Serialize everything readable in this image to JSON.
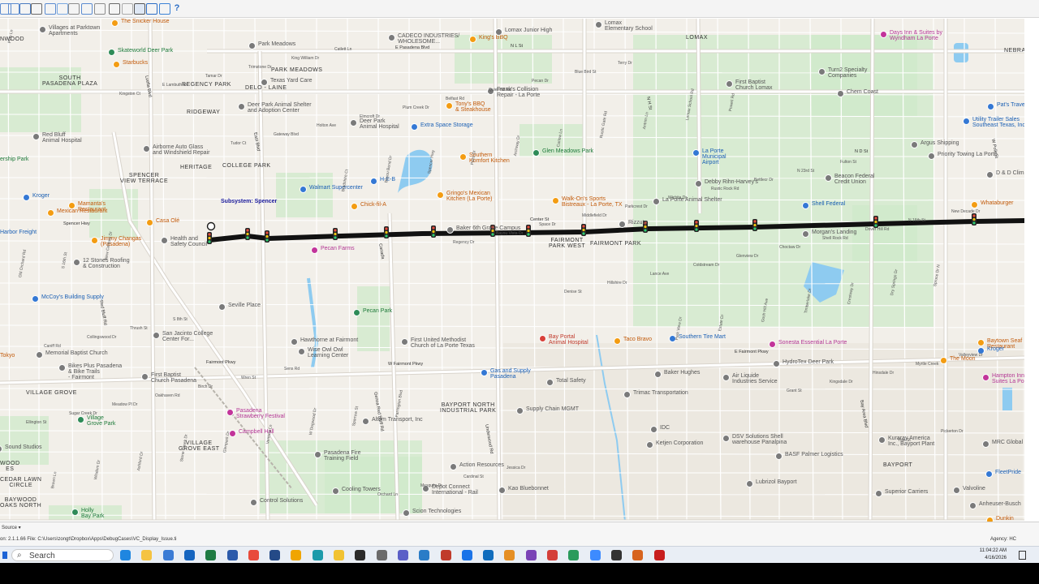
{
  "colors": {
    "map_bg": "#f2efe9",
    "park": "#cfe9c9",
    "water": "#8ecbf0",
    "road_major": "#ffffff",
    "road_stroke": "#d9d4cc",
    "corridor": "#111111"
  },
  "toolbar": {
    "icons": [
      "file-icon",
      "open-icon",
      "save-icon",
      "print-icon",
      "text-icon",
      "image-icon",
      "layout-icon",
      "chart-icon",
      "table-icon",
      "crop-icon",
      "pointer-icon",
      "select-icon",
      "zoom-icon",
      "pin-icon",
      "help-icon"
    ]
  },
  "map": {
    "corridor_label": "Subsystem: Spencer",
    "areas": [
      {
        "id": "pasadena-plaza",
        "text": "SOUTH\nPASADENA PLAZA"
      },
      {
        "id": "spencer-view",
        "text": "SPENCER\nVIEW TERRACE"
      },
      {
        "id": "heritage",
        "text": "HERITAGE"
      },
      {
        "id": "college-park",
        "text": "COLLEGE PARK"
      },
      {
        "id": "regency-park",
        "text": "REGENCY PARK"
      },
      {
        "id": "ridgeway",
        "text": "RIDGEWAY"
      },
      {
        "id": "delo-laine",
        "text": "DELO - LAINE"
      },
      {
        "id": "park-meadows",
        "text": "PARK MEADOWS"
      },
      {
        "id": "fairmont-park",
        "text": "FAIRMONT PARK"
      },
      {
        "id": "fairmont-park-west",
        "text": "FAIRMONT\nPARK WEST"
      },
      {
        "id": "village-grove",
        "text": "VILLAGE GROVE"
      },
      {
        "id": "village-grove-east",
        "text": "VILLAGE\nGROVE EAST"
      },
      {
        "id": "baypor-north",
        "text": "BAYPORT NORTH\nINDUSTRIAL PARK"
      },
      {
        "id": "bayport",
        "text": "BAYPORT"
      },
      {
        "id": "lomax",
        "text": "LOMAX"
      },
      {
        "id": "cedar-lawn",
        "text": "CEDAR LAWN\nCIRCLE"
      },
      {
        "id": "baywood",
        "text": "BAYWOOD\nOAKS NORTH"
      },
      {
        "id": "nebraska",
        "text": "NEBRA"
      },
      {
        "id": "lynwood",
        "text": "NWOOD"
      },
      {
        "id": "woods",
        "text": "WOOD\nES"
      }
    ],
    "pois": [
      {
        "t": "Villages at Parktown\nApartments",
        "c": "d"
      },
      {
        "t": "Skateworld Deer Park",
        "c": "g"
      },
      {
        "t": "Starbucks",
        "c": "o"
      },
      {
        "t": "Park Meadows",
        "c": "d"
      },
      {
        "t": "CADECO INDUSTRIES/\nWHOLESOME...",
        "c": "d"
      },
      {
        "t": "King's BBQ",
        "c": "o"
      },
      {
        "t": "Lomax Junior High",
        "c": "d"
      },
      {
        "t": "Lomax\nElementary School",
        "c": "d"
      },
      {
        "t": "Days Inn & Suites by\nWyndham La Porte",
        "c": "p"
      },
      {
        "t": "Texas Yard Care",
        "c": "d"
      },
      {
        "t": "Frank's Collision\nRepair - La Porte",
        "c": "d"
      },
      {
        "t": "First Baptist\nChurch Lomax",
        "c": "d"
      },
      {
        "t": "Turn2 Specialty\nCompanies",
        "c": "d"
      },
      {
        "t": "Chem Coast",
        "c": "d"
      },
      {
        "t": "Pat's Travel C",
        "c": "b"
      },
      {
        "t": "Deer Park Animal Shelter\nand Adoption Center",
        "c": "d"
      },
      {
        "t": "Tony's BBQ\n& Steakhouse",
        "c": "o"
      },
      {
        "t": "Deer Park\nAnimal Hospital",
        "c": "d"
      },
      {
        "t": "Extra Space Storage",
        "c": "b"
      },
      {
        "t": "Red Bluff\nAnimal Hospital",
        "c": "d"
      },
      {
        "t": "Airborne Auto Glass\nand Windshield Repair",
        "c": "d"
      },
      {
        "t": "Southern\nKomfort Kitchen",
        "c": "o"
      },
      {
        "t": "Glen Meadows Park",
        "c": "g"
      },
      {
        "t": "Utility Trailer Sales\nSoutheast Texas, Inc",
        "c": "b"
      },
      {
        "t": "Argus Shipping",
        "c": "d"
      },
      {
        "t": "Priority Towing La Porte",
        "c": "d"
      },
      {
        "t": "La Porte\nMunicipal\nAirport",
        "c": "b"
      },
      {
        "t": "Debby Rihn-Harvey's",
        "c": "d"
      },
      {
        "t": "Beacon Federal\nCredit Union",
        "c": "d"
      },
      {
        "t": "D & D Climate Con",
        "c": "d"
      },
      {
        "t": "Walmart Supercenter",
        "c": "b"
      },
      {
        "t": "H-E-B",
        "c": "b"
      },
      {
        "t": "Kroger",
        "c": "b"
      },
      {
        "t": "Mamanta's\nRestaurant",
        "c": "o"
      },
      {
        "t": "Mexican Restaurant",
        "c": "o"
      },
      {
        "t": "Gringo's Mexican\nKitchen (La Porte)",
        "c": "o"
      },
      {
        "t": "Chick-fil-A",
        "c": "o"
      },
      {
        "t": "Walk-On's Sports\nBistreaux - La Porte, TX",
        "c": "o"
      },
      {
        "t": "La Porte Animal Shelter",
        "c": "d"
      },
      {
        "t": "Shell Federal",
        "c": "b"
      },
      {
        "t": "Whataburger",
        "c": "o"
      },
      {
        "t": "Casa Olé",
        "c": "o"
      },
      {
        "t": "Harbor Freight",
        "c": "b"
      },
      {
        "t": "Jimmy Changas\n(Pasadena)",
        "c": "o"
      },
      {
        "t": "Health and\nSafety Council",
        "c": "d"
      },
      {
        "t": "Baker 6th Grade Campus",
        "c": "d"
      },
      {
        "t": "Rizzuto",
        "c": "d"
      },
      {
        "t": "Morgan's Landing",
        "c": "d"
      },
      {
        "t": "Pecan Farms",
        "c": "p"
      },
      {
        "t": "12 Stones Roofing\n& Construction",
        "c": "d"
      },
      {
        "t": "McCoy's Building Supply",
        "c": "b"
      },
      {
        "t": "Seville Place",
        "c": "d"
      },
      {
        "t": "Pecan Park",
        "c": "g"
      },
      {
        "t": "San Jacinto College\nCenter For...",
        "c": "d"
      },
      {
        "t": "Hawthorne at Fairmont",
        "c": "d"
      },
      {
        "t": "Wise Owl Owl\nLearning Center",
        "c": "d"
      },
      {
        "t": "First United Methodist\nChurch of La Porte Texas",
        "c": "d"
      },
      {
        "t": "Bay Portal\nAnimal Hospital",
        "c": "r"
      },
      {
        "t": "Taco Bravo",
        "c": "o"
      },
      {
        "t": "Southern Tire Mart",
        "c": "b"
      },
      {
        "t": "Sonesta Essential La Porte",
        "c": "p"
      },
      {
        "t": "Baytown Seaf\nRestaurant",
        "c": "o"
      },
      {
        "t": "Kroger",
        "c": "b"
      },
      {
        "t": "Tokyo",
        "c": "o"
      },
      {
        "t": "Memorial Baptist Church",
        "c": "d"
      },
      {
        "t": "HydroTex Deer Park",
        "c": "d"
      },
      {
        "t": "The Moon",
        "c": "o"
      },
      {
        "t": "Bikes Plus Pasadena\n& Bike Trails\n- Fairmont",
        "c": "d"
      },
      {
        "t": "First Baptist\nChurch Pasadena",
        "c": "d"
      },
      {
        "t": "Gas and Supply\nPasadena",
        "c": "b"
      },
      {
        "t": "Total Safety",
        "c": "d"
      },
      {
        "t": "Baker Hughes",
        "c": "d"
      },
      {
        "t": "Air Liquide\nIndustries Service",
        "c": "d"
      },
      {
        "t": "Hampton Inn &\nSuites La Porte",
        "c": "p"
      },
      {
        "t": "Trimac Transportation",
        "c": "d"
      },
      {
        "t": "Pasadena\nStrawberry Festival",
        "c": "p"
      },
      {
        "t": "Village\nGrove Park",
        "c": "g"
      },
      {
        "t": "Supply Chain MGMT",
        "c": "d"
      },
      {
        "t": "Altom Transport, Inc",
        "c": "d"
      },
      {
        "t": "Campbell Hall",
        "c": "p"
      },
      {
        "t": "IDC",
        "c": "d"
      },
      {
        "t": "Ketjen Corporation",
        "c": "d"
      },
      {
        "t": "DSV Solutions Shell\nwarehouse Panalpina",
        "c": "d"
      },
      {
        "t": "Kuraray America\nInc., Bayport Plant",
        "c": "d"
      },
      {
        "t": "MRC Global",
        "c": "d"
      },
      {
        "t": "Sound Studios",
        "c": "d"
      },
      {
        "t": "BASF Palmer Logistics",
        "c": "d"
      },
      {
        "t": "FleetPride",
        "c": "b"
      },
      {
        "t": "Pasadena Fire\nTraining Field",
        "c": "d"
      },
      {
        "t": "Action Resources",
        "c": "d"
      },
      {
        "t": "Lubrizol Bayport",
        "c": "d"
      },
      {
        "t": "Superior Carriers",
        "c": "d"
      },
      {
        "t": "Valvoline",
        "c": "d"
      },
      {
        "t": "Cooling Towers",
        "c": "d"
      },
      {
        "t": "Depot Connect\nInternational - Rail",
        "c": "d"
      },
      {
        "t": "Kao Bluebonnet",
        "c": "d"
      },
      {
        "t": "Anheuser-Busch",
        "c": "d"
      },
      {
        "t": "Control Solutions",
        "c": "d"
      },
      {
        "t": "Scion Technologies",
        "c": "d"
      },
      {
        "t": "Dunkin",
        "c": "o"
      },
      {
        "t": "ership Park",
        "c": "g"
      },
      {
        "t": "Holly\nBay Park",
        "c": "g"
      },
      {
        "t": "The Snicker House",
        "c": "o"
      }
    ],
    "roads": {
      "major": [
        "E Pasadena Blvd",
        "Spencer Hwy",
        "Fairmont Pkwy",
        "W Fairmont Pkwy",
        "Red Bluff Rd",
        "Genoa Red Bluff Rd",
        "Underwood Rd",
        "Bay Area Blvd",
        "E Fairmont Pkwy",
        "N L St",
        "N H St",
        "N D St",
        "W Polk St",
        "Canada",
        "East Blvd",
        "Luella Blvd",
        "Center St",
        "Old Orchard Rd"
      ],
      "minor": [
        "Pine Ln",
        "Kingston Ct",
        "Tudor Ct",
        "Bradshire Ct",
        "Regency Dr",
        "Denise St",
        "Park View Dr",
        "Grant St",
        "Yale St",
        "Brown Ln",
        "E Lambuth Ln",
        "Gateway Blvd",
        "Bayou Bend Dr",
        "Bayou Vista Dr",
        "Hillshire Dr",
        "Estate Dr",
        "Kingsdale Dr",
        "Pickerton Dr",
        "Wisdom Dr",
        "Tamar Dr",
        "Holton Ave",
        "Spencer Hwy",
        "Space Dr",
        "Lance Ave",
        "Gosh Hill Ave",
        "Hinsdale Dr",
        "Ellington St",
        "Ashford Dr",
        "Trimstone Dr",
        "Elmcroft Dr",
        "Paris Dr",
        "Middlefield Dr",
        "Coldstream Dr",
        "Timberlake Dr",
        "Myrtle Creek",
        "Sugar Creek Dr",
        "Stone Creek Dr",
        "King William Dr",
        "Plum Creek Dr",
        "Archway Dr",
        "Parkcrest Dr",
        "Glenview Dr",
        "Crestway Dr",
        "Valleyview Dr",
        "Meadow Pl Dr",
        "Glenpark Dr",
        "Catlett Ln",
        "Belfast Rd",
        "Carlow Ln",
        "Wichita Dr",
        "Choctaw Dr",
        "Dry Springs Dr",
        "Caniff Rd",
        "Oakhaven Rd",
        "Ventura Ln",
        "Orchard Ln",
        "Quiet Hill Rd",
        "Rustic Gate Rd",
        "Rustic Rock Rd",
        "Shell Rock Rd",
        "Spruce Dr N",
        "Collingswood Dr",
        "Birch Dr",
        "W Dogwood Dr",
        "Mesquite Dr",
        "Pecan Dr",
        "Antrim Ln",
        "Bettlecr Dr",
        "Dover Hill Rd",
        "Old Orchard Rd",
        "Thrush St",
        "Wren St",
        "Sparrow St",
        "Cardinal St",
        "Blue Bird St",
        "Lomax School Rd",
        "N 23rd St",
        "N 16th St",
        "S 16th St",
        "S 8th St",
        "Sens Rd",
        "Farrington Blvd",
        "Jessica Dr",
        "Terry Dr",
        "Powell Rd",
        "Fulton St",
        "New Decade Dr",
        "New Century Dr"
      ]
    },
    "signals_count": 17
  },
  "statusbar": {
    "source_label": "Source",
    "version_text": "on: 2.1.1.66   File: C:\\Users\\zongt\\Dropbox\\Apps\\DebugCases\\VC_Display_Issue.ti",
    "agency_text": "Agency: HC"
  },
  "taskbar": {
    "search_placeholder": "Search",
    "time": "11:04:22 AM",
    "date": "4/16/2026",
    "app_icons": [
      "edge-icon",
      "explorer-icon",
      "store-icon",
      "outlook-icon",
      "excel-icon",
      "word-icon",
      "chrome-icon",
      "powershell-icon",
      "app-icon",
      "photos-icon",
      "notes-icon",
      "terminal-icon",
      "settings-icon",
      "teams-icon",
      "vscode-icon",
      "sqlserver-icon",
      "calendar-icon",
      "mail-icon",
      "app2-icon",
      "app3-icon",
      "app4-icon",
      "app5-icon",
      "app6-icon",
      "media-icon",
      "app7-icon",
      "acrobat-icon"
    ]
  }
}
